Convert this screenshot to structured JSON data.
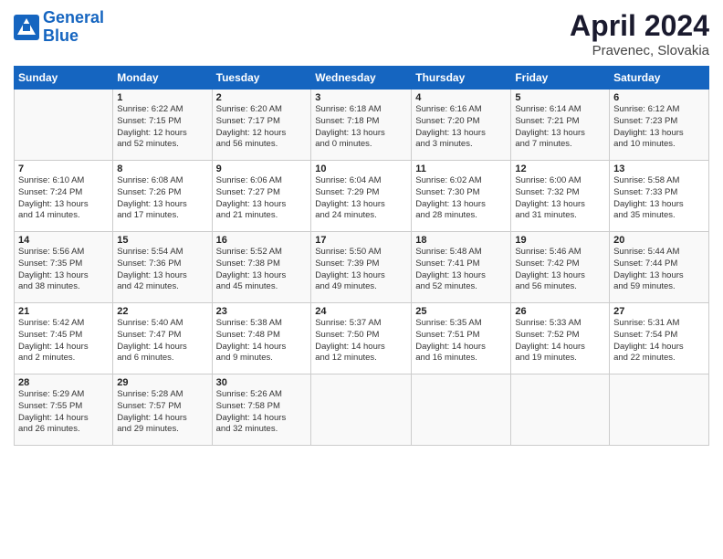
{
  "logo": {
    "line1": "General",
    "line2": "Blue"
  },
  "title": "April 2024",
  "subtitle": "Pravenec, Slovakia",
  "header": {
    "days": [
      "Sunday",
      "Monday",
      "Tuesday",
      "Wednesday",
      "Thursday",
      "Friday",
      "Saturday"
    ]
  },
  "weeks": [
    [
      {
        "day": "",
        "info": ""
      },
      {
        "day": "1",
        "info": "Sunrise: 6:22 AM\nSunset: 7:15 PM\nDaylight: 12 hours\nand 52 minutes."
      },
      {
        "day": "2",
        "info": "Sunrise: 6:20 AM\nSunset: 7:17 PM\nDaylight: 12 hours\nand 56 minutes."
      },
      {
        "day": "3",
        "info": "Sunrise: 6:18 AM\nSunset: 7:18 PM\nDaylight: 13 hours\nand 0 minutes."
      },
      {
        "day": "4",
        "info": "Sunrise: 6:16 AM\nSunset: 7:20 PM\nDaylight: 13 hours\nand 3 minutes."
      },
      {
        "day": "5",
        "info": "Sunrise: 6:14 AM\nSunset: 7:21 PM\nDaylight: 13 hours\nand 7 minutes."
      },
      {
        "day": "6",
        "info": "Sunrise: 6:12 AM\nSunset: 7:23 PM\nDaylight: 13 hours\nand 10 minutes."
      }
    ],
    [
      {
        "day": "7",
        "info": "Sunrise: 6:10 AM\nSunset: 7:24 PM\nDaylight: 13 hours\nand 14 minutes."
      },
      {
        "day": "8",
        "info": "Sunrise: 6:08 AM\nSunset: 7:26 PM\nDaylight: 13 hours\nand 17 minutes."
      },
      {
        "day": "9",
        "info": "Sunrise: 6:06 AM\nSunset: 7:27 PM\nDaylight: 13 hours\nand 21 minutes."
      },
      {
        "day": "10",
        "info": "Sunrise: 6:04 AM\nSunset: 7:29 PM\nDaylight: 13 hours\nand 24 minutes."
      },
      {
        "day": "11",
        "info": "Sunrise: 6:02 AM\nSunset: 7:30 PM\nDaylight: 13 hours\nand 28 minutes."
      },
      {
        "day": "12",
        "info": "Sunrise: 6:00 AM\nSunset: 7:32 PM\nDaylight: 13 hours\nand 31 minutes."
      },
      {
        "day": "13",
        "info": "Sunrise: 5:58 AM\nSunset: 7:33 PM\nDaylight: 13 hours\nand 35 minutes."
      }
    ],
    [
      {
        "day": "14",
        "info": "Sunrise: 5:56 AM\nSunset: 7:35 PM\nDaylight: 13 hours\nand 38 minutes."
      },
      {
        "day": "15",
        "info": "Sunrise: 5:54 AM\nSunset: 7:36 PM\nDaylight: 13 hours\nand 42 minutes."
      },
      {
        "day": "16",
        "info": "Sunrise: 5:52 AM\nSunset: 7:38 PM\nDaylight: 13 hours\nand 45 minutes."
      },
      {
        "day": "17",
        "info": "Sunrise: 5:50 AM\nSunset: 7:39 PM\nDaylight: 13 hours\nand 49 minutes."
      },
      {
        "day": "18",
        "info": "Sunrise: 5:48 AM\nSunset: 7:41 PM\nDaylight: 13 hours\nand 52 minutes."
      },
      {
        "day": "19",
        "info": "Sunrise: 5:46 AM\nSunset: 7:42 PM\nDaylight: 13 hours\nand 56 minutes."
      },
      {
        "day": "20",
        "info": "Sunrise: 5:44 AM\nSunset: 7:44 PM\nDaylight: 13 hours\nand 59 minutes."
      }
    ],
    [
      {
        "day": "21",
        "info": "Sunrise: 5:42 AM\nSunset: 7:45 PM\nDaylight: 14 hours\nand 2 minutes."
      },
      {
        "day": "22",
        "info": "Sunrise: 5:40 AM\nSunset: 7:47 PM\nDaylight: 14 hours\nand 6 minutes."
      },
      {
        "day": "23",
        "info": "Sunrise: 5:38 AM\nSunset: 7:48 PM\nDaylight: 14 hours\nand 9 minutes."
      },
      {
        "day": "24",
        "info": "Sunrise: 5:37 AM\nSunset: 7:50 PM\nDaylight: 14 hours\nand 12 minutes."
      },
      {
        "day": "25",
        "info": "Sunrise: 5:35 AM\nSunset: 7:51 PM\nDaylight: 14 hours\nand 16 minutes."
      },
      {
        "day": "26",
        "info": "Sunrise: 5:33 AM\nSunset: 7:52 PM\nDaylight: 14 hours\nand 19 minutes."
      },
      {
        "day": "27",
        "info": "Sunrise: 5:31 AM\nSunset: 7:54 PM\nDaylight: 14 hours\nand 22 minutes."
      }
    ],
    [
      {
        "day": "28",
        "info": "Sunrise: 5:29 AM\nSunset: 7:55 PM\nDaylight: 14 hours\nand 26 minutes."
      },
      {
        "day": "29",
        "info": "Sunrise: 5:28 AM\nSunset: 7:57 PM\nDaylight: 14 hours\nand 29 minutes."
      },
      {
        "day": "30",
        "info": "Sunrise: 5:26 AM\nSunset: 7:58 PM\nDaylight: 14 hours\nand 32 minutes."
      },
      {
        "day": "",
        "info": ""
      },
      {
        "day": "",
        "info": ""
      },
      {
        "day": "",
        "info": ""
      },
      {
        "day": "",
        "info": ""
      }
    ]
  ]
}
